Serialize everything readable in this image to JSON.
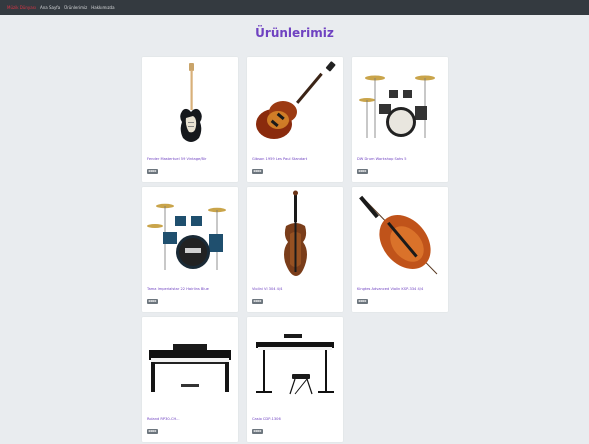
{
  "colors": {
    "navbar_bg": "#343a40",
    "brand": "#dc3545",
    "title": "#6f42c1",
    "product_name": "#6f42c1",
    "badge_bg": "#6c757d",
    "page_bg": "#e9ecef"
  },
  "navbar": {
    "brand": "Müzik Dünyası",
    "links": [
      "Ana Sayfa",
      "Ürünlerimiz",
      "Hakkımızda"
    ]
  },
  "page": {
    "title": "Ürünlerimiz"
  },
  "products": [
    {
      "name": "Fender Mastertuel 59 Vintage/Bir",
      "badge": "0000",
      "image_icon": "electric-guitar-icon"
    },
    {
      "name": "Gibson 1959 Les Paul Standart",
      "badge": "0000",
      "image_icon": "les-paul-guitar-icon"
    },
    {
      "name": "DW Drum Workshop Sahs 5",
      "badge": "0000",
      "image_icon": "drum-kit-icon"
    },
    {
      "name": "Tama Imperialstar 22 Hairlins Blue",
      "badge": "0000",
      "image_icon": "drum-kit-icon"
    },
    {
      "name": "Violini VI 304 4/4",
      "badge": "0000",
      "image_icon": "violin-icon"
    },
    {
      "name": "Kingtes Advanced Violin KSP-334 4/4",
      "badge": "0000",
      "image_icon": "violin-icon"
    },
    {
      "name": "Roland RP30-CH...",
      "badge": "0000",
      "image_icon": "digital-piano-icon"
    },
    {
      "name": "Casio CDP-1306",
      "badge": "0000",
      "image_icon": "keyboard-stand-icon"
    }
  ]
}
